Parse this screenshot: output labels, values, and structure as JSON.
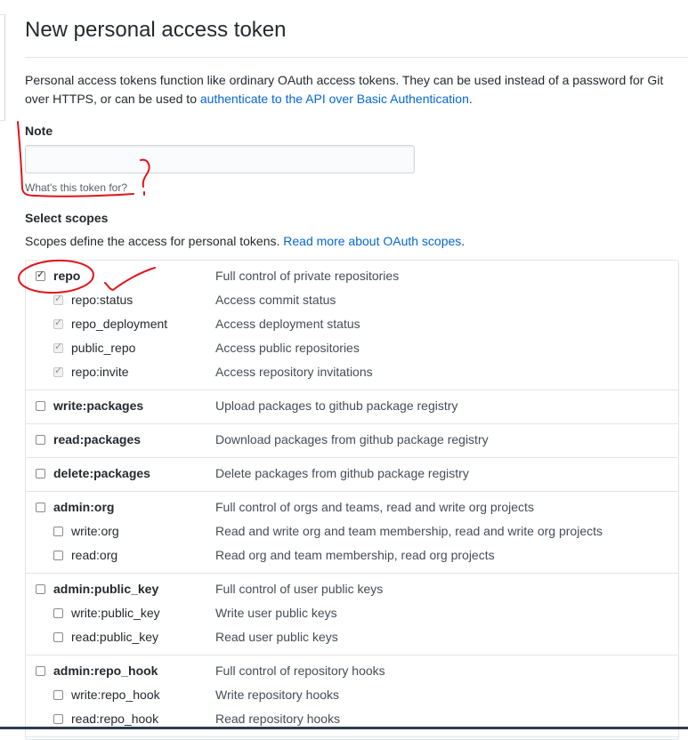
{
  "page": {
    "title": "New personal access token",
    "intro_text": "Personal access tokens function like ordinary OAuth access tokens. They can be used instead of a password for Git over HTTPS, or can be used to ",
    "intro_link": "authenticate to the API over Basic Authentication",
    "intro_end": "."
  },
  "note": {
    "label": "Note",
    "value": "",
    "placeholder": "",
    "hint": "What's this token for?"
  },
  "scopes": {
    "label": "Select scopes",
    "description": "Scopes define the access for personal tokens. ",
    "link": "Read more about OAuth scopes",
    "link_end": ".",
    "groups": [
      {
        "name": "repo",
        "desc": "Full control of private repositories",
        "checked": true,
        "children": [
          {
            "name": "repo:status",
            "desc": "Access commit status",
            "checked": true
          },
          {
            "name": "repo_deployment",
            "desc": "Access deployment status",
            "checked": true
          },
          {
            "name": "public_repo",
            "desc": "Access public repositories",
            "checked": true
          },
          {
            "name": "repo:invite",
            "desc": "Access repository invitations",
            "checked": true
          }
        ]
      },
      {
        "name": "write:packages",
        "desc": "Upload packages to github package registry",
        "checked": false,
        "children": []
      },
      {
        "name": "read:packages",
        "desc": "Download packages from github package registry",
        "checked": false,
        "children": []
      },
      {
        "name": "delete:packages",
        "desc": "Delete packages from github package registry",
        "checked": false,
        "children": []
      },
      {
        "name": "admin:org",
        "desc": "Full control of orgs and teams, read and write org projects",
        "checked": false,
        "children": [
          {
            "name": "write:org",
            "desc": "Read and write org and team membership, read and write org projects",
            "checked": false
          },
          {
            "name": "read:org",
            "desc": "Read org and team membership, read org projects",
            "checked": false
          }
        ]
      },
      {
        "name": "admin:public_key",
        "desc": "Full control of user public keys",
        "checked": false,
        "children": [
          {
            "name": "write:public_key",
            "desc": "Write user public keys",
            "checked": false
          },
          {
            "name": "read:public_key",
            "desc": "Read user public keys",
            "checked": false
          }
        ]
      },
      {
        "name": "admin:repo_hook",
        "desc": "Full control of repository hooks",
        "checked": false,
        "children": [
          {
            "name": "write:repo_hook",
            "desc": "Write repository hooks",
            "checked": false
          },
          {
            "name": "read:repo_hook",
            "desc": "Read repository hooks",
            "checked": false
          }
        ]
      }
    ]
  },
  "colors": {
    "link": "#0366d6",
    "annotation": "#e0141c",
    "border": "#e1e4e8"
  }
}
